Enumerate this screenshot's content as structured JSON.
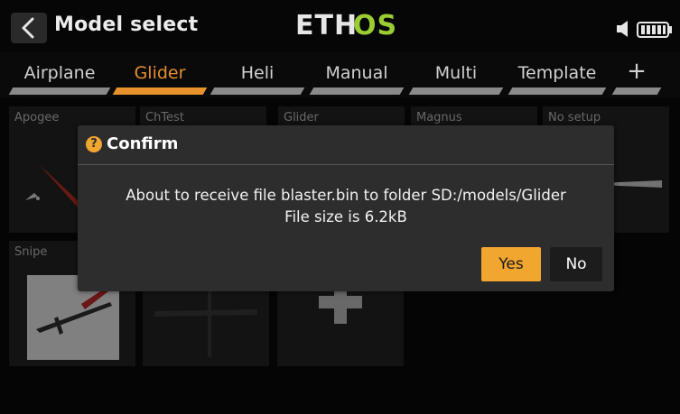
{
  "header": {
    "title": "Model select",
    "logo_left": "ETH",
    "logo_right": "OS",
    "back_icon": "chevron-left-icon",
    "volume_icon": "speaker-icon",
    "battery_icon": "battery-icon"
  },
  "tabs": [
    {
      "label": "Airplane",
      "active": false
    },
    {
      "label": "Glider",
      "active": true
    },
    {
      "label": "Heli",
      "active": false
    },
    {
      "label": "Manual",
      "active": false
    },
    {
      "label": "Multi",
      "active": false
    },
    {
      "label": "Template",
      "active": false
    },
    {
      "label": "+",
      "active": false
    }
  ],
  "models": [
    {
      "name": "Apogee"
    },
    {
      "name": "ChTest"
    },
    {
      "name": "Glider"
    },
    {
      "name": "Magnus"
    },
    {
      "name": "No setup"
    },
    {
      "name": "Snipe"
    },
    {
      "name": ""
    },
    {
      "name": ""
    }
  ],
  "dialog": {
    "title": "Confirm",
    "icon": "question-icon",
    "icon_glyph": "?",
    "message_line1": "About to receive file blaster.bin to folder SD:/models/Glider",
    "message_line2": "File size is 6.2kB",
    "yes_label": "Yes",
    "no_label": "No"
  },
  "colors": {
    "accent": "#f1a630",
    "tab_active": "#e8922e",
    "logo_green": "#9acd32",
    "dialog_bg": "#2d2d2d"
  }
}
